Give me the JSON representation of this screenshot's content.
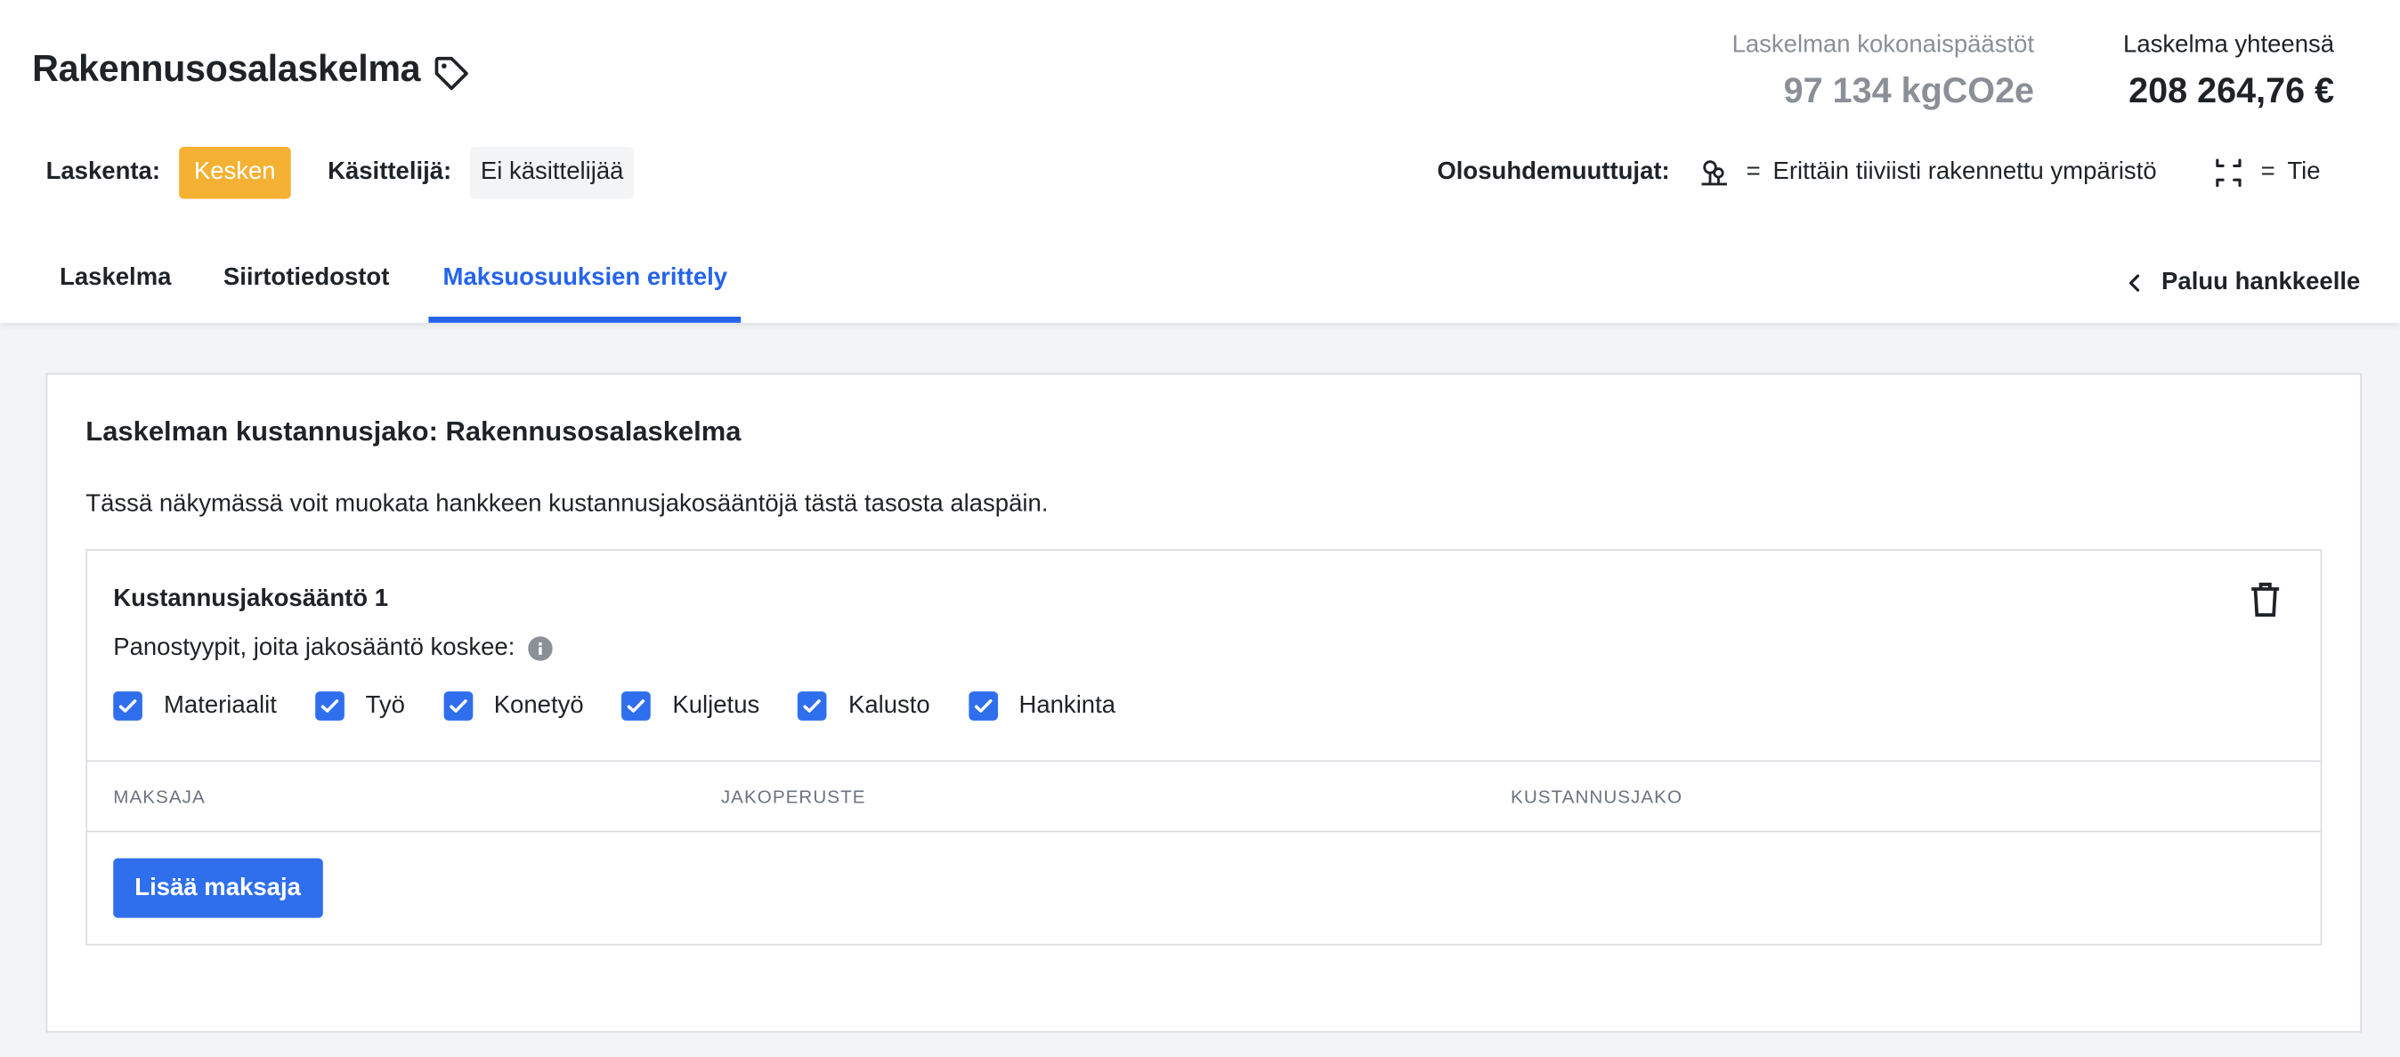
{
  "header": {
    "title": "Rakennusosalaskelma",
    "emissions_label": "Laskelman kokonaispäästöt",
    "emissions_value": "97 134 kgCO2e",
    "total_label": "Laskelma yhteensä",
    "total_value": "208 264,76 €"
  },
  "meta": {
    "status_label": "Laskenta:",
    "status_value": "Kesken",
    "handler_label": "Käsittelijä:",
    "handler_value": "Ei käsittelijää"
  },
  "conditions": {
    "label": "Olosuhdemuuttujat:",
    "items": [
      {
        "icon": "urban-environment-icon",
        "equals": "=",
        "text": "Erittäin tiiviisti rakennettu ympäristö"
      },
      {
        "icon": "road-icon",
        "equals": "=",
        "text": "Tie"
      }
    ]
  },
  "tabs": [
    {
      "label": "Laskelma",
      "active": false
    },
    {
      "label": "Siirtotiedostot",
      "active": false
    },
    {
      "label": "Maksuosuuksien erittely",
      "active": true
    }
  ],
  "back_link": "Paluu hankkeelle",
  "card": {
    "title": "Laskelman kustannusjako: Rakennusosalaskelma",
    "description": "Tässä näkymässä voit muokata hankkeen kustannusjakosääntöjä tästä tasosta alaspäin.",
    "rule": {
      "title": "Kustannusjakosääntö 1",
      "subtitle": "Panostyypit, joita jakosääntö koskee:",
      "checkboxes": [
        {
          "label": "Materiaalit",
          "checked": true
        },
        {
          "label": "Työ",
          "checked": true
        },
        {
          "label": "Konetyö",
          "checked": true
        },
        {
          "label": "Kuljetus",
          "checked": true
        },
        {
          "label": "Kalusto",
          "checked": true
        },
        {
          "label": "Hankinta",
          "checked": true
        }
      ],
      "columns": [
        "MAKSAJA",
        "JAKOPERUSTE",
        "KUSTANNUSJAKO"
      ],
      "add_button": "Lisää maksaja"
    }
  },
  "colors": {
    "accent": "#2563eb",
    "button": "#2f6fed",
    "status_badge": "#f5b133",
    "muted": "#8a8f98"
  }
}
